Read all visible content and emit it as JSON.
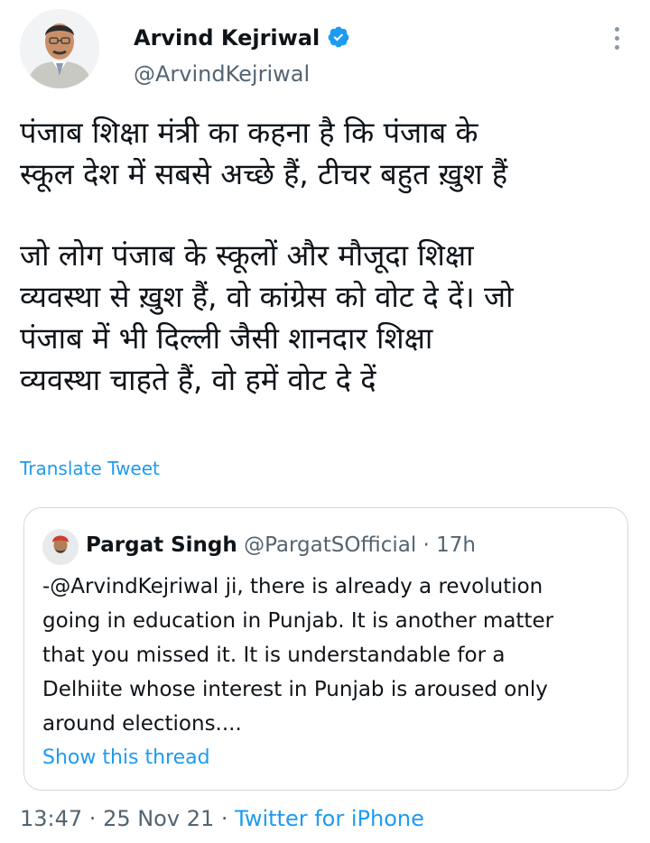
{
  "author": {
    "name": "Arvind Kejriwal",
    "handle": "@ArvindKejriwal",
    "verified": true
  },
  "tweet": {
    "paragraphs": [
      "पंजाब शिक्षा मंत्री का कहना है कि पंजाब के\nस्कूल देश में सबसे अच्छे हैं, टीचर बहुत ख़ुश हैं",
      "जो लोग पंजाब के स्कूलों और मौजूदा शिक्षा\nव्यवस्था से ख़ुश हैं, वो कांग्रेस को वोट दे दें। जो\nपंजाब में भी दिल्ली जैसी शानदार शिक्षा\nव्यवस्था चाहते हैं, वो हमें वोट दे दें"
    ],
    "translate_label": "Translate Tweet"
  },
  "quote": {
    "name": "Pargat Singh",
    "handle": "@PargatSOfficial",
    "separator": " · ",
    "time": "17h",
    "text": "-@ArvindKejriwal ji, there is already a revolution\ngoing in education in Punjab. It is another matter\nthat you  missed it. It is understandable for a\nDelhiite whose interest in Punjab is aroused only\naround elections....",
    "show_thread_label": "Show this thread"
  },
  "footer": {
    "time": "13:47",
    "date": "25 Nov 21",
    "separator": " · ",
    "source": "Twitter for iPhone"
  },
  "icons": {
    "verified": "verified-badge-icon",
    "more": "more-options-icon"
  },
  "colors": {
    "accent": "#1d9bf0",
    "text": "#0f1419",
    "secondary": "#536471",
    "border": "#cfd9de"
  }
}
